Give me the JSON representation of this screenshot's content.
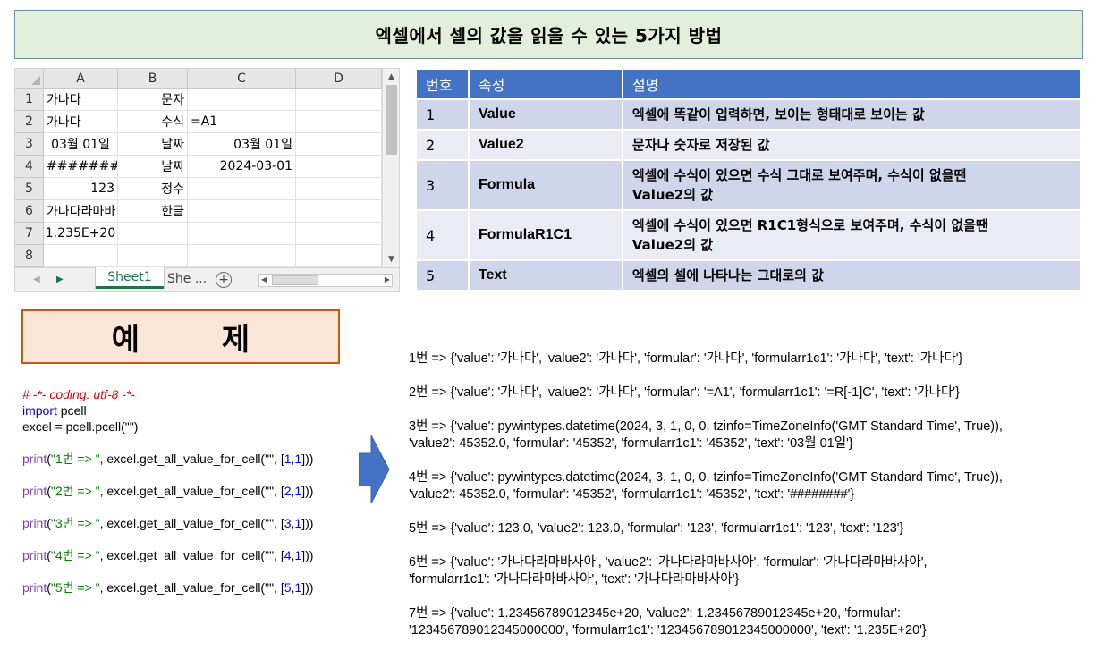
{
  "banner": {
    "title": "엑셀에서 셀의 값을 읽을 수 있는 5가지 방법"
  },
  "sheet": {
    "columns": [
      "A",
      "B",
      "C",
      "D"
    ],
    "rows": [
      "1",
      "2",
      "3",
      "4",
      "5",
      "6",
      "7",
      "8"
    ],
    "cells": {
      "r1": {
        "a": "가나다",
        "b": "문자",
        "c": ""
      },
      "r2": {
        "a": "가나다",
        "b": "수식",
        "c": "=A1"
      },
      "r3": {
        "a": "03월 01일",
        "b": "날짜",
        "c": "03월 01일"
      },
      "r4": {
        "a": "########",
        "b": "날짜",
        "c": "2024-03-01"
      },
      "r5": {
        "a": "123",
        "b": "정수",
        "c": ""
      },
      "r6": {
        "a": "가나다라마바",
        "b": "한글",
        "c": ""
      },
      "r7": {
        "a": "1.235E+20",
        "b": "",
        "c": ""
      }
    },
    "tabs": {
      "active": "Sheet1",
      "next": "She ...",
      "add_symbol": "+"
    }
  },
  "props_table": {
    "headers": {
      "no": "번호",
      "attr": "속성",
      "desc": "설명"
    },
    "rows": [
      {
        "no": "1",
        "attr": "Value",
        "desc": "엑셀에 똑같이 입력하면, 보이는 형태대로 보이는 값"
      },
      {
        "no": "2",
        "attr": "Value2",
        "desc": "문자나 숫자로 저장된 값"
      },
      {
        "no": "3",
        "attr": "Formula",
        "desc_l1": "엑셀에 수식이 있으면 수식 그대로 보여주며, 수식이 없을땐",
        "desc_l2": "Value2의 값"
      },
      {
        "no": "4",
        "attr": "FormulaR1C1",
        "desc_l1": "엑셀에 수식이 있으면 R1C1형식으로 보여주며, 수식이 없을땐",
        "desc_l2": "Value2의 값"
      },
      {
        "no": "5",
        "attr": "Text",
        "desc": "엑셀의 셀에 나타나는 그대로의 값"
      }
    ]
  },
  "example_label": "예 제",
  "code": {
    "comment": "# -*- coding: utf-8 -*-",
    "import_kw": "import",
    "import_mod": " pcell",
    "assign": "excel = pcell.pcell(\"\")",
    "prints": [
      {
        "fn": "print",
        "open": "(",
        "str": "\"1번 => \"",
        "mid": ", excel.get_all_value_for_cell(\"\", [",
        "n1": "1",
        "comma": ",",
        "n2": "1",
        "close": "]))"
      },
      {
        "fn": "print",
        "open": "(",
        "str": "\"2번 => \"",
        "mid": ", excel.get_all_value_for_cell(\"\", [",
        "n1": "2",
        "comma": ",",
        "n2": "1",
        "close": "]))"
      },
      {
        "fn": "print",
        "open": "(",
        "str": "\"3번 => \"",
        "mid": ", excel.get_all_value_for_cell(\"\", [",
        "n1": "3",
        "comma": ",",
        "n2": "1",
        "close": "]))"
      },
      {
        "fn": "print",
        "open": "(",
        "str": "\"4번 => \"",
        "mid": ", excel.get_all_value_for_cell(\"\", [",
        "n1": "4",
        "comma": ",",
        "n2": "1",
        "close": "]))"
      },
      {
        "fn": "print",
        "open": "(",
        "str": "\"5번 => \"",
        "mid": ", excel.get_all_value_for_cell(\"\", [",
        "n1": "5",
        "comma": ",",
        "n2": "1",
        "close": "]))"
      }
    ]
  },
  "output": [
    {
      "l1": "1번 =>   {'value': '가나다', 'value2': '가나다', 'formular': '가나다', 'formularr1c1': '가나다', 'text': '가나다'}"
    },
    {
      "l1": "2번 =>   {'value': '가나다', 'value2': '가나다', 'formular': '=A1', 'formularr1c1': '=R[-1]C', 'text': '가나다'}"
    },
    {
      "l1": "3번 =>   {'value': pywintypes.datetime(2024, 3, 1, 0, 0, tzinfo=TimeZoneInfo('GMT Standard Time', True)),",
      "l2": "'value2': 45352.0, 'formular': '45352', 'formularr1c1': '45352', 'text': '03월 01일'}"
    },
    {
      "l1": "4번 =>   {'value': pywintypes.datetime(2024, 3, 1, 0, 0, tzinfo=TimeZoneInfo('GMT Standard Time', True)),",
      "l2": "'value2': 45352.0, 'formular': '45352', 'formularr1c1': '45352', 'text': '########'}"
    },
    {
      "l1": "5번 =>   {'value': 123.0, 'value2': 123.0, 'formular': '123', 'formularr1c1': '123', 'text': '123'}"
    },
    {
      "l1": "6번 =>   {'value': '가나다라마바사아', 'value2': '가나다라마바사아', 'formular': '가나다라마바사아',",
      "l2": "'formularr1c1': '가나다라마바사아', 'text': '가나다라마바사아'}"
    },
    {
      "l1": "7번 =>   {'value': 1.23456789012345e+20, 'value2': 1.23456789012345e+20, 'formular':",
      "l2": "'123456789012345000000', 'formularr1c1': '123456789012345000000', 'text': '1.235E+20'}"
    }
  ],
  "colors": {
    "banner_bg": "#e2efda",
    "table_header": "#4472c4",
    "table_row_odd": "#cfd5ea",
    "table_row_even": "#e9ebf5",
    "example_bg": "#fbe5d6",
    "example_border": "#c55a11",
    "arrow": "#4472c4",
    "excel_green": "#217346"
  }
}
